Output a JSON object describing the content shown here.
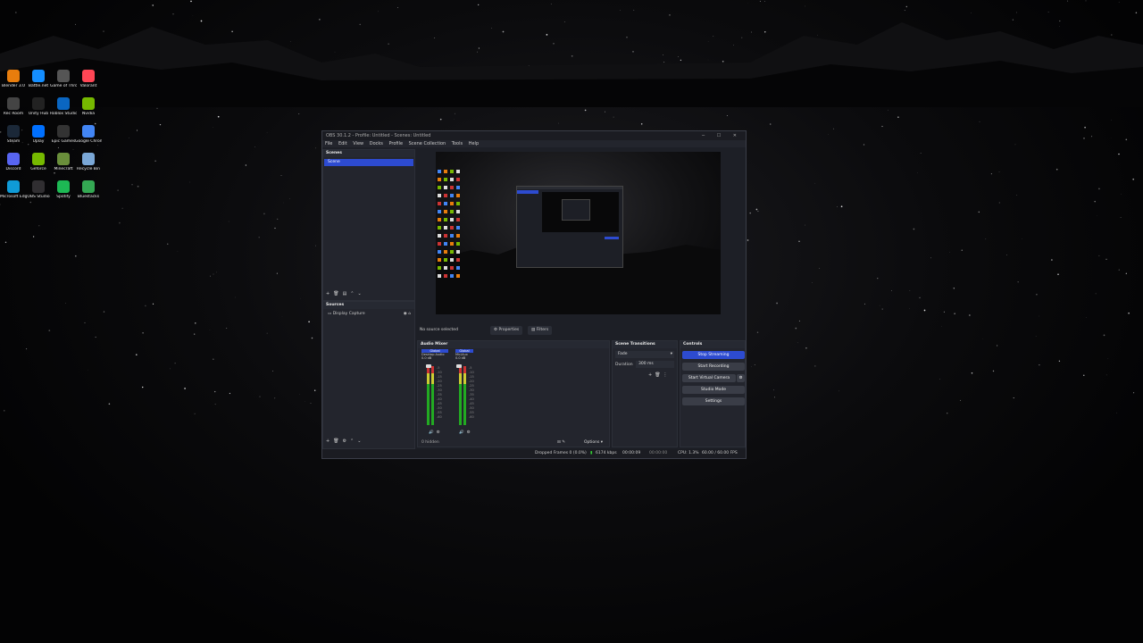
{
  "desktop": {
    "icons": [
      {
        "label": "Blender 3.0",
        "color": "#e87d0d"
      },
      {
        "label": "Battle.net",
        "color": "#148eff"
      },
      {
        "label": "Game of Thrones",
        "color": "#555"
      },
      {
        "label": "Valorant",
        "color": "#ff4655"
      },
      {
        "label": "Rec Room",
        "color": "#444"
      },
      {
        "label": "Unity Hub",
        "color": "#222"
      },
      {
        "label": "Roblox Studio",
        "color": "#0a66c2"
      },
      {
        "label": "Nvidia",
        "color": "#76b900"
      },
      {
        "label": "Steam",
        "color": "#1b2838"
      },
      {
        "label": "Uplay",
        "color": "#0070ff"
      },
      {
        "label": "Epic Games",
        "color": "#333"
      },
      {
        "label": "Google Chrome",
        "color": "#4285f4"
      },
      {
        "label": "Discord",
        "color": "#5865f2"
      },
      {
        "label": "Geforce",
        "color": "#76b900"
      },
      {
        "label": "Minecraft",
        "color": "#6a8f3b"
      },
      {
        "label": "Recycle Bin",
        "color": "#7aa7d6"
      },
      {
        "label": "Microsoft Edge",
        "color": "#0f9bd7"
      },
      {
        "label": "OBS Studio",
        "color": "#302e31"
      },
      {
        "label": "Spotify",
        "color": "#1db954"
      },
      {
        "label": "Bluestacks",
        "color": "#34a853"
      }
    ]
  },
  "obs": {
    "title": "OBS 30.1.2 - Profile: Untitled - Scenes: Untitled",
    "window_controls": "─ ☐ ✕",
    "menu": [
      "File",
      "Edit",
      "View",
      "Docks",
      "Profile",
      "Scene Collection",
      "Tools",
      "Help"
    ],
    "scenes": {
      "header": "Scenes",
      "items": [
        "Scene"
      ]
    },
    "sources": {
      "header": "Sources",
      "items": [
        "Display Capture"
      ]
    },
    "no_source": "No source selected",
    "properties_label": "Properties",
    "filters_label": "Filters",
    "audio_mixer": {
      "header": "Audio Mixer",
      "channels": [
        {
          "name": "Global",
          "label": "Desktop Audio",
          "level": "0.0 dB"
        },
        {
          "name": "Global",
          "label": "Mic/Aux",
          "level": "0.0 dB"
        }
      ],
      "hidden": "0 hidden",
      "options": "Options"
    },
    "transitions": {
      "header": "Scene Transitions",
      "type": "Fade",
      "duration_label": "Duration",
      "duration": "300 ms"
    },
    "controls": {
      "header": "Controls",
      "stop_streaming": "Stop Streaming",
      "start_recording": "Start Recording",
      "start_virtual_camera": "Start Virtual Camera",
      "studio_mode": "Studio Mode",
      "settings": "Settings"
    },
    "status": {
      "dropped": "Dropped Frames 0 (0.0%)",
      "bitrate": "6174 kbps",
      "stream_time": "00:00:09",
      "rec_time": "00:00:00",
      "cpu": "CPU: 1.3%",
      "fps": "60.00 / 60.00 FPS"
    }
  }
}
